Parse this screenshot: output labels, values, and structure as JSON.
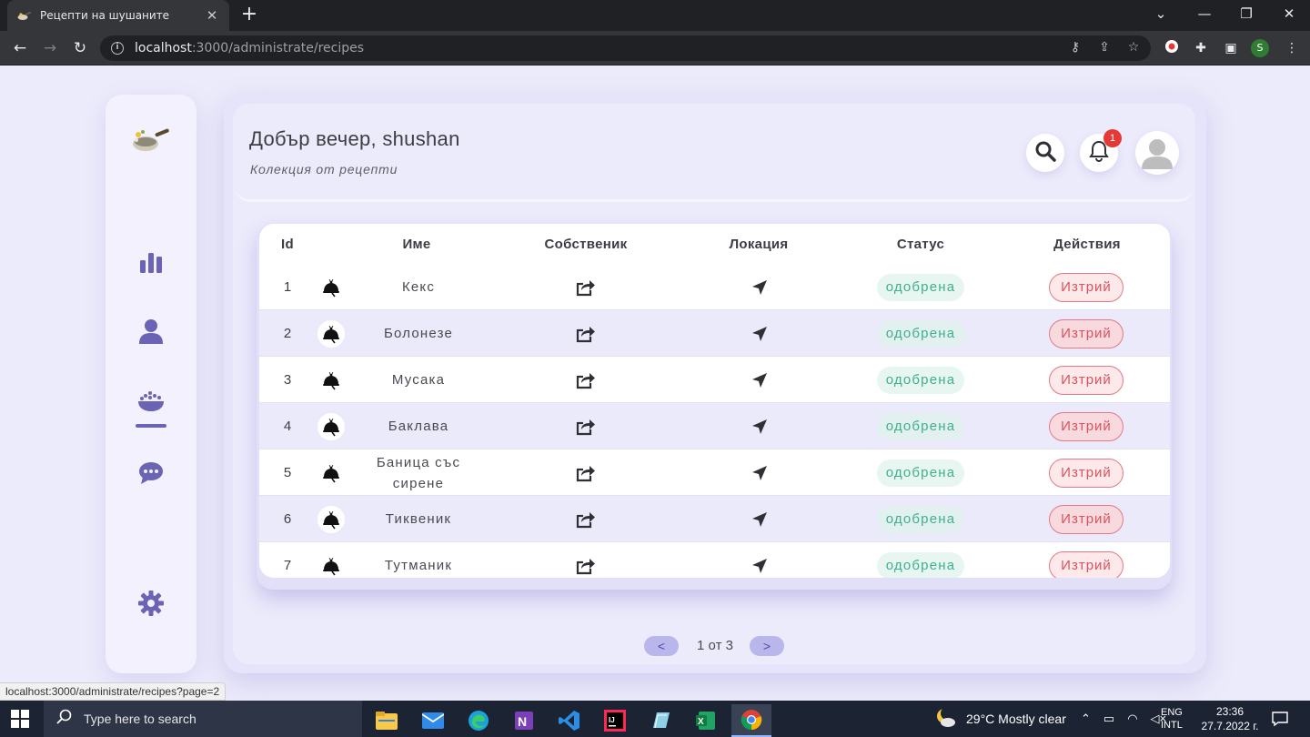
{
  "browser": {
    "tab_title": "Рецепти на шушаните",
    "url_host": "localhost",
    "url_path": ":3000/administrate/recipes",
    "profile_initial": "S",
    "status_url": "localhost:3000/administrate/recipes?page=2"
  },
  "header": {
    "greeting": "Добър вечер, shushan",
    "subtitle": "Колекция от рецепти",
    "notification_count": "1"
  },
  "sidebar": {
    "items": [
      "logo",
      "chart-icon",
      "user-icon",
      "recipes-icon",
      "chat-icon",
      "gear-icon"
    ],
    "active": "recipes"
  },
  "table": {
    "headers": {
      "id": "Id",
      "name": "Име",
      "owner": "Собственик",
      "location": "Локация",
      "status": "Статус",
      "actions": "Действия"
    },
    "rows": [
      {
        "id": "1",
        "name": "Кекс",
        "status": "одобрена",
        "action": "Изтрий"
      },
      {
        "id": "2",
        "name": "Болонезе",
        "status": "одобрена",
        "action": "Изтрий"
      },
      {
        "id": "3",
        "name": "Мусака",
        "status": "одобрена",
        "action": "Изтрий"
      },
      {
        "id": "4",
        "name": "Баклава",
        "status": "одобрена",
        "action": "Изтрий"
      },
      {
        "id": "5",
        "name": "Баница със сирене",
        "status": "одобрена",
        "action": "Изтрий"
      },
      {
        "id": "6",
        "name": "Тиквеник",
        "status": "одобрена",
        "action": "Изтрий"
      },
      {
        "id": "7",
        "name": "Тутманик",
        "status": "одобрена",
        "action": "Изтрий"
      }
    ]
  },
  "pagination": {
    "prev": "<",
    "next": ">",
    "text": "1 от 3"
  },
  "taskbar": {
    "search_placeholder": "Type here to search",
    "weather": "29°C  Mostly clear",
    "lang_top": "ENG",
    "lang_bottom": "INTL",
    "time": "23:36",
    "date": "27.7.2022 г."
  },
  "colors": {
    "accent": "#6b63b3",
    "background": "#ecebfb",
    "status_green": "#3fb08a",
    "delete_red": "#d9535f",
    "badge_red": "#e53935"
  }
}
